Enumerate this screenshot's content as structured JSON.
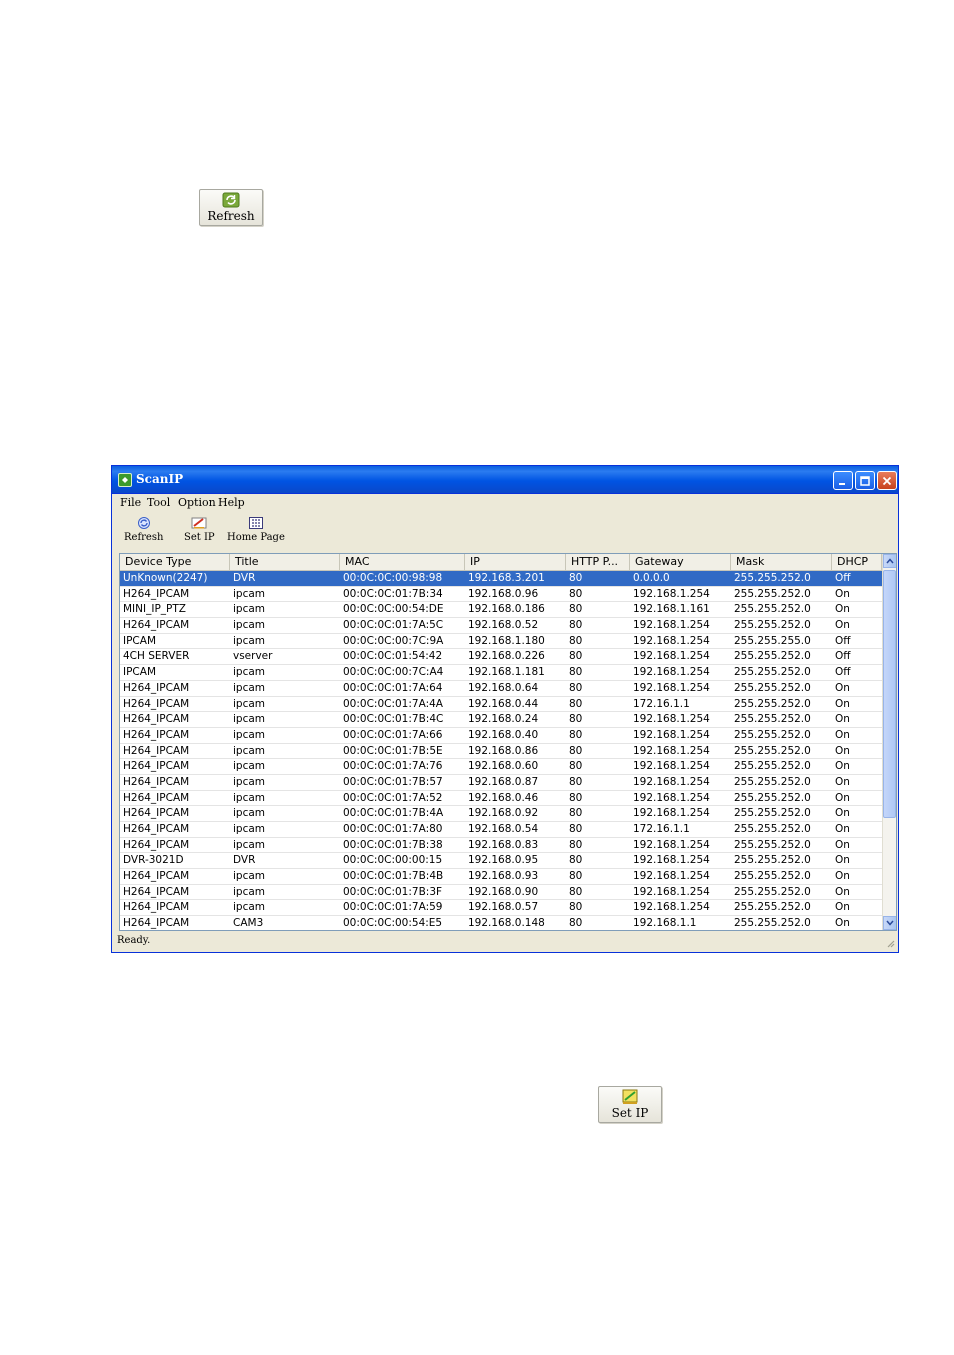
{
  "doc_refresh_button": {
    "label": "Refresh"
  },
  "doc_setip_button": {
    "label": "Set IP"
  },
  "window": {
    "title": "ScanIP",
    "menu": [
      "File",
      "Tool",
      "Option",
      "Help"
    ],
    "toolbar": [
      {
        "label": "Refresh",
        "icon": "refresh-icon"
      },
      {
        "label": "Set IP",
        "icon": "set-ip-icon"
      },
      {
        "label": "Home Page",
        "icon": "home-page-icon"
      }
    ],
    "status": "Ready.",
    "selection_color": "#316ac5",
    "titlebar_color": "#0054e3"
  },
  "table": {
    "columns": [
      "Device Type",
      "Title",
      "MAC",
      "IP",
      "HTTP P...",
      "Gateway",
      "Mask",
      "DHCP"
    ],
    "rows": [
      [
        "UnKnown(2247)",
        "DVR",
        "00:0C:0C:00:98:98",
        "192.168.3.201",
        "80",
        "0.0.0.0",
        "255.255.252.0",
        "Off"
      ],
      [
        "H264_IPCAM",
        "ipcam",
        "00:0C:0C:01:7B:34",
        "192.168.0.96",
        "80",
        "192.168.1.254",
        "255.255.252.0",
        "On"
      ],
      [
        "MINI_IP_PTZ",
        "ipcam",
        "00:0C:0C:00:54:DE",
        "192.168.0.186",
        "80",
        "192.168.1.161",
        "255.255.252.0",
        "On"
      ],
      [
        "H264_IPCAM",
        "ipcam",
        "00:0C:0C:01:7A:5C",
        "192.168.0.52",
        "80",
        "192.168.1.254",
        "255.255.252.0",
        "On"
      ],
      [
        "IPCAM",
        "ipcam",
        "00:0C:0C:00:7C:9A",
        "192.168.1.180",
        "80",
        "192.168.1.254",
        "255.255.255.0",
        "Off"
      ],
      [
        "4CH SERVER",
        "vserver",
        "00:0C:0C:01:54:42",
        "192.168.0.226",
        "80",
        "192.168.1.254",
        "255.255.252.0",
        "Off"
      ],
      [
        "IPCAM",
        "ipcam",
        "00:0C:0C:00:7C:A4",
        "192.168.1.181",
        "80",
        "192.168.1.254",
        "255.255.252.0",
        "Off"
      ],
      [
        "H264_IPCAM",
        "ipcam",
        "00:0C:0C:01:7A:64",
        "192.168.0.64",
        "80",
        "192.168.1.254",
        "255.255.252.0",
        "On"
      ],
      [
        "H264_IPCAM",
        "ipcam",
        "00:0C:0C:01:7A:4A",
        "192.168.0.44",
        "80",
        "172.16.1.1",
        "255.255.252.0",
        "On"
      ],
      [
        "H264_IPCAM",
        "ipcam",
        "00:0C:0C:01:7B:4C",
        "192.168.0.24",
        "80",
        "192.168.1.254",
        "255.255.252.0",
        "On"
      ],
      [
        "H264_IPCAM",
        "ipcam",
        "00:0C:0C:01:7A:66",
        "192.168.0.40",
        "80",
        "192.168.1.254",
        "255.255.252.0",
        "On"
      ],
      [
        "H264_IPCAM",
        "ipcam",
        "00:0C:0C:01:7B:5E",
        "192.168.0.86",
        "80",
        "192.168.1.254",
        "255.255.252.0",
        "On"
      ],
      [
        "H264_IPCAM",
        "ipcam",
        "00:0C:0C:01:7A:76",
        "192.168.0.60",
        "80",
        "192.168.1.254",
        "255.255.252.0",
        "On"
      ],
      [
        "H264_IPCAM",
        "ipcam",
        "00:0C:0C:01:7B:57",
        "192.168.0.87",
        "80",
        "192.168.1.254",
        "255.255.252.0",
        "On"
      ],
      [
        "H264_IPCAM",
        "ipcam",
        "00:0C:0C:01:7A:52",
        "192.168.0.46",
        "80",
        "192.168.1.254",
        "255.255.252.0",
        "On"
      ],
      [
        "H264_IPCAM",
        "ipcam",
        "00:0C:0C:01:7B:4A",
        "192.168.0.92",
        "80",
        "192.168.1.254",
        "255.255.252.0",
        "On"
      ],
      [
        "H264_IPCAM",
        "ipcam",
        "00:0C:0C:01:7A:80",
        "192.168.0.54",
        "80",
        "172.16.1.1",
        "255.255.252.0",
        "On"
      ],
      [
        "H264_IPCAM",
        "ipcam",
        "00:0C:0C:01:7B:38",
        "192.168.0.83",
        "80",
        "192.168.1.254",
        "255.255.252.0",
        "On"
      ],
      [
        "DVR-3021D",
        "DVR",
        "00:0C:0C:00:00:15",
        "192.168.0.95",
        "80",
        "192.168.1.254",
        "255.255.252.0",
        "On"
      ],
      [
        "H264_IPCAM",
        "ipcam",
        "00:0C:0C:01:7B:4B",
        "192.168.0.93",
        "80",
        "192.168.1.254",
        "255.255.252.0",
        "On"
      ],
      [
        "H264_IPCAM",
        "ipcam",
        "00:0C:0C:01:7B:3F",
        "192.168.0.90",
        "80",
        "192.168.1.254",
        "255.255.252.0",
        "On"
      ],
      [
        "H264_IPCAM",
        "ipcam",
        "00:0C:0C:01:7A:59",
        "192.168.0.57",
        "80",
        "192.168.1.254",
        "255.255.252.0",
        "On"
      ],
      [
        "H264_IPCAM",
        "CAM3",
        "00:0C:0C:00:54:E5",
        "192.168.0.148",
        "80",
        "192.168.1.1",
        "255.255.252.0",
        "On"
      ]
    ],
    "selected_row": 0
  }
}
